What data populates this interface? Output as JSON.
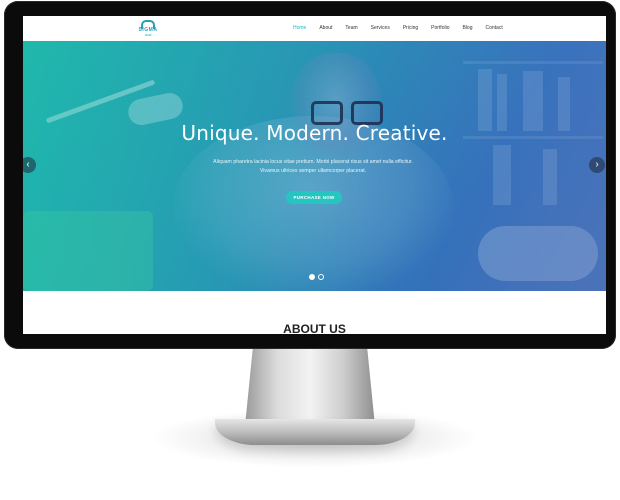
{
  "brand": {
    "logo_text": "SIGMA",
    "logo_subtext": "dual"
  },
  "nav": {
    "items": [
      "Home",
      "About",
      "Team",
      "Services",
      "Pricing",
      "Portfolio",
      "Blog",
      "Contact"
    ],
    "active": "Home",
    "accent_color": "#25b7c8"
  },
  "hero": {
    "title": "Unique. Modern. Creative.",
    "subtitle": "Aliquam pharetra lacinia locus vitae pretium. Morbi placerat risus sit amet nulla efficitur. Vivamus ultrices semper ullamcorper placerat.",
    "cta_label": "PURCHASE NOW",
    "prev_glyph": "‹",
    "next_glyph": "›",
    "slide_count": 2,
    "active_slide": 1,
    "gradient_colors": [
      "#21b5ad",
      "#2697b4",
      "#3070b8",
      "#4a6fb0"
    ]
  },
  "about": {
    "heading": "ABOUT US"
  },
  "icons": {
    "prev": "chevron-left-icon",
    "next": "chevron-right-icon"
  }
}
